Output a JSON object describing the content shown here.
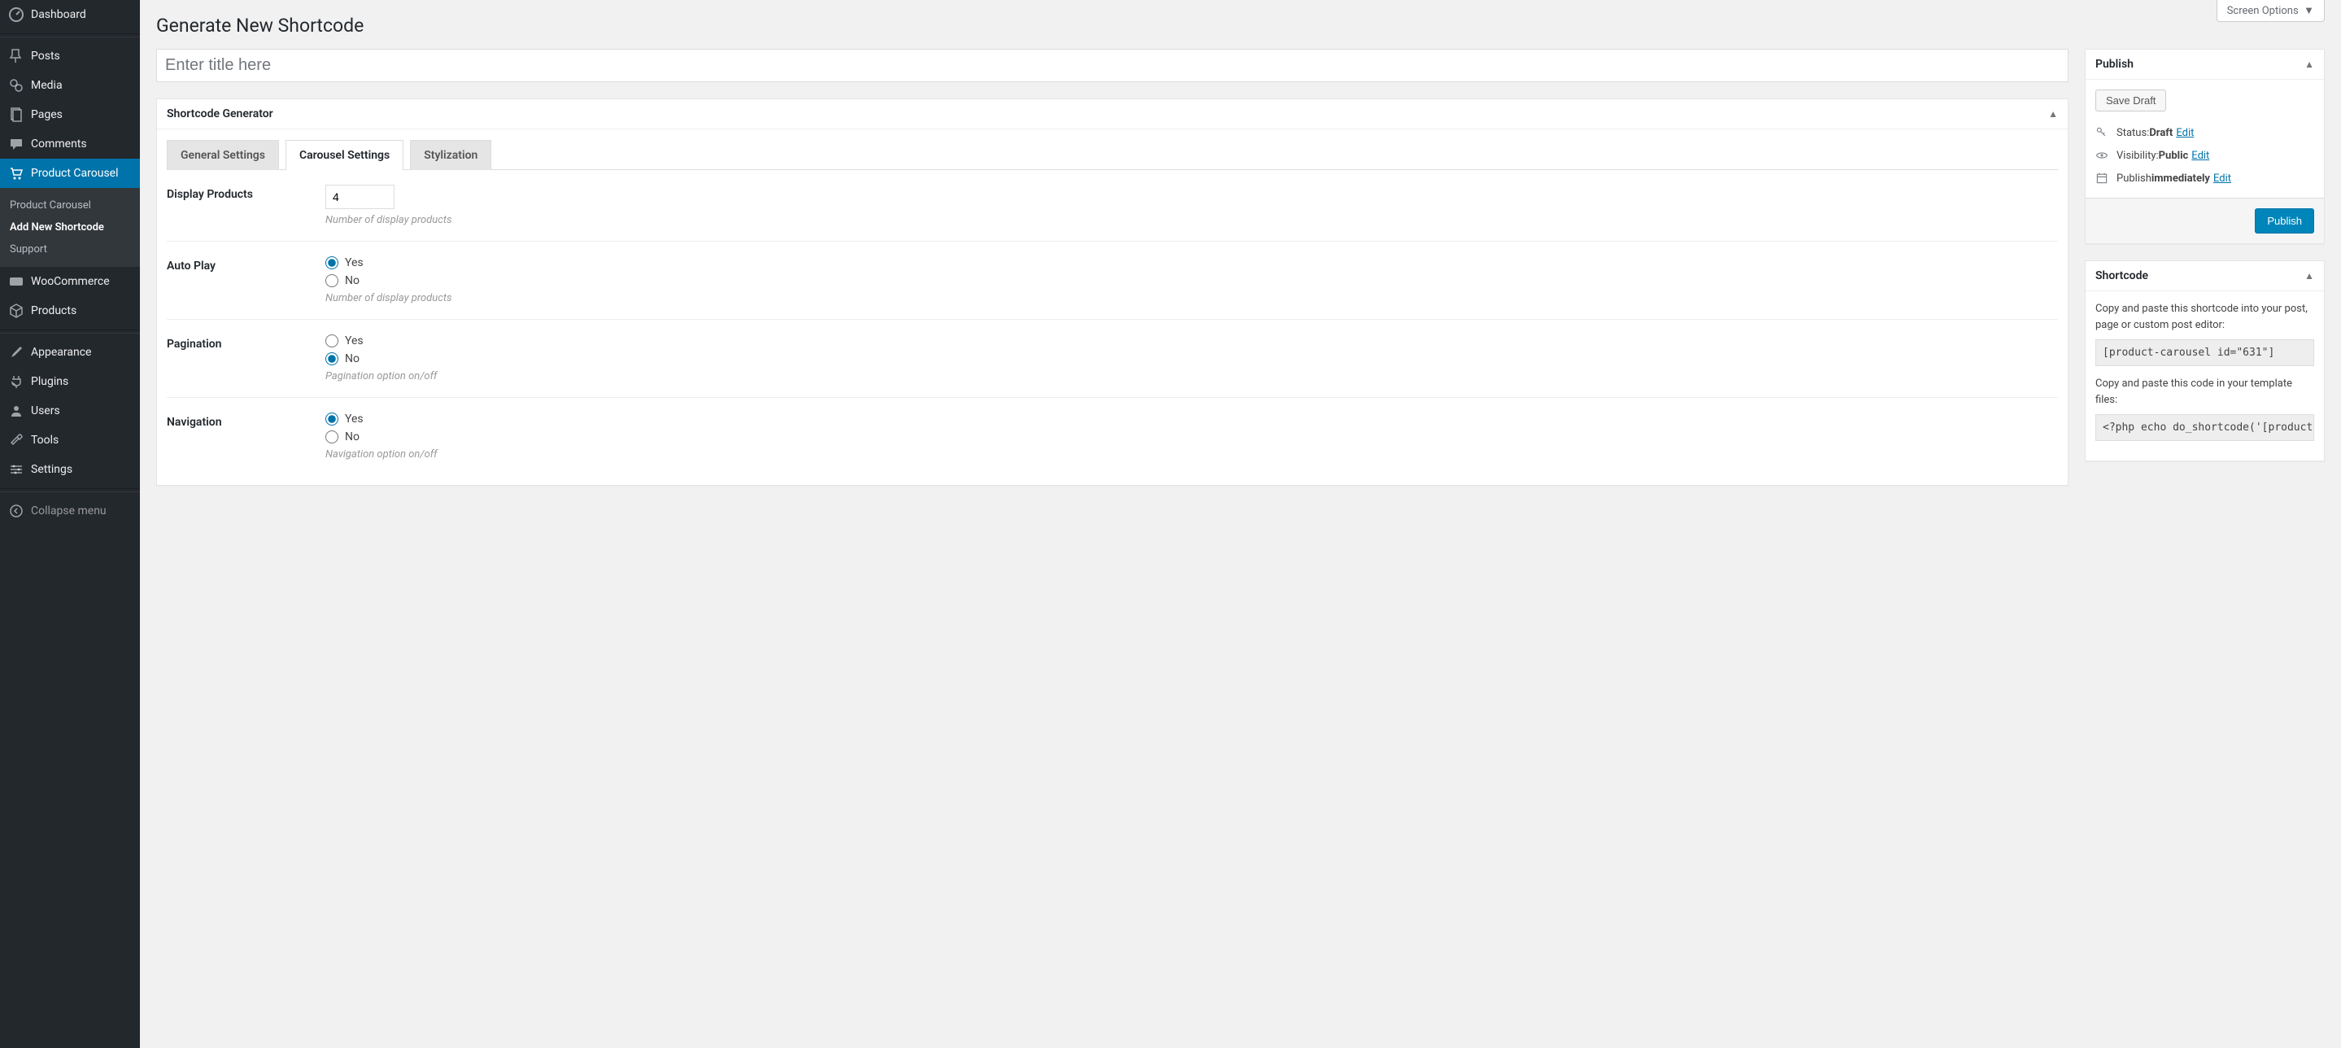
{
  "screenOptions": "Screen Options",
  "pageTitle": "Generate New Shortcode",
  "titlePlaceholder": "Enter title here",
  "sidebar": {
    "items": [
      {
        "label": "Dashboard"
      },
      {
        "label": "Posts"
      },
      {
        "label": "Media"
      },
      {
        "label": "Pages"
      },
      {
        "label": "Comments"
      },
      {
        "label": "Product Carousel"
      },
      {
        "label": "WooCommerce"
      },
      {
        "label": "Products"
      },
      {
        "label": "Appearance"
      },
      {
        "label": "Plugins"
      },
      {
        "label": "Users"
      },
      {
        "label": "Tools"
      },
      {
        "label": "Settings"
      },
      {
        "label": "Collapse menu"
      }
    ],
    "submenu": [
      {
        "label": "Product Carousel"
      },
      {
        "label": "Add New Shortcode"
      },
      {
        "label": "Support"
      }
    ]
  },
  "generator": {
    "title": "Shortcode Generator",
    "tabs": [
      "General Settings",
      "Carousel Settings",
      "Stylization"
    ],
    "fields": {
      "displayProducts": {
        "label": "Display Products",
        "value": "4",
        "desc": "Number of display products"
      },
      "autoPlay": {
        "label": "Auto Play",
        "yes": "Yes",
        "no": "No",
        "desc": "Number of display products"
      },
      "pagination": {
        "label": "Pagination",
        "yes": "Yes",
        "no": "No",
        "desc": "Pagination option on/off"
      },
      "navigation": {
        "label": "Navigation",
        "yes": "Yes",
        "no": "No",
        "desc": "Navigation option on/off"
      }
    }
  },
  "publish": {
    "title": "Publish",
    "saveDraft": "Save Draft",
    "statusLabel": "Status: ",
    "statusValue": "Draft",
    "visibilityLabel": "Visibility: ",
    "visibilityValue": "Public",
    "publishLabel": "Publish ",
    "publishValue": "immediately",
    "edit": "Edit",
    "publishBtn": "Publish"
  },
  "shortcode": {
    "title": "Shortcode",
    "text1": "Copy and paste this shortcode into your post, page or custom post editor:",
    "code1": "[product-carousel id=\"631\"]",
    "text2": "Copy and paste this code in your template files:",
    "code2": "<?php  echo do_shortcode('[product"
  }
}
